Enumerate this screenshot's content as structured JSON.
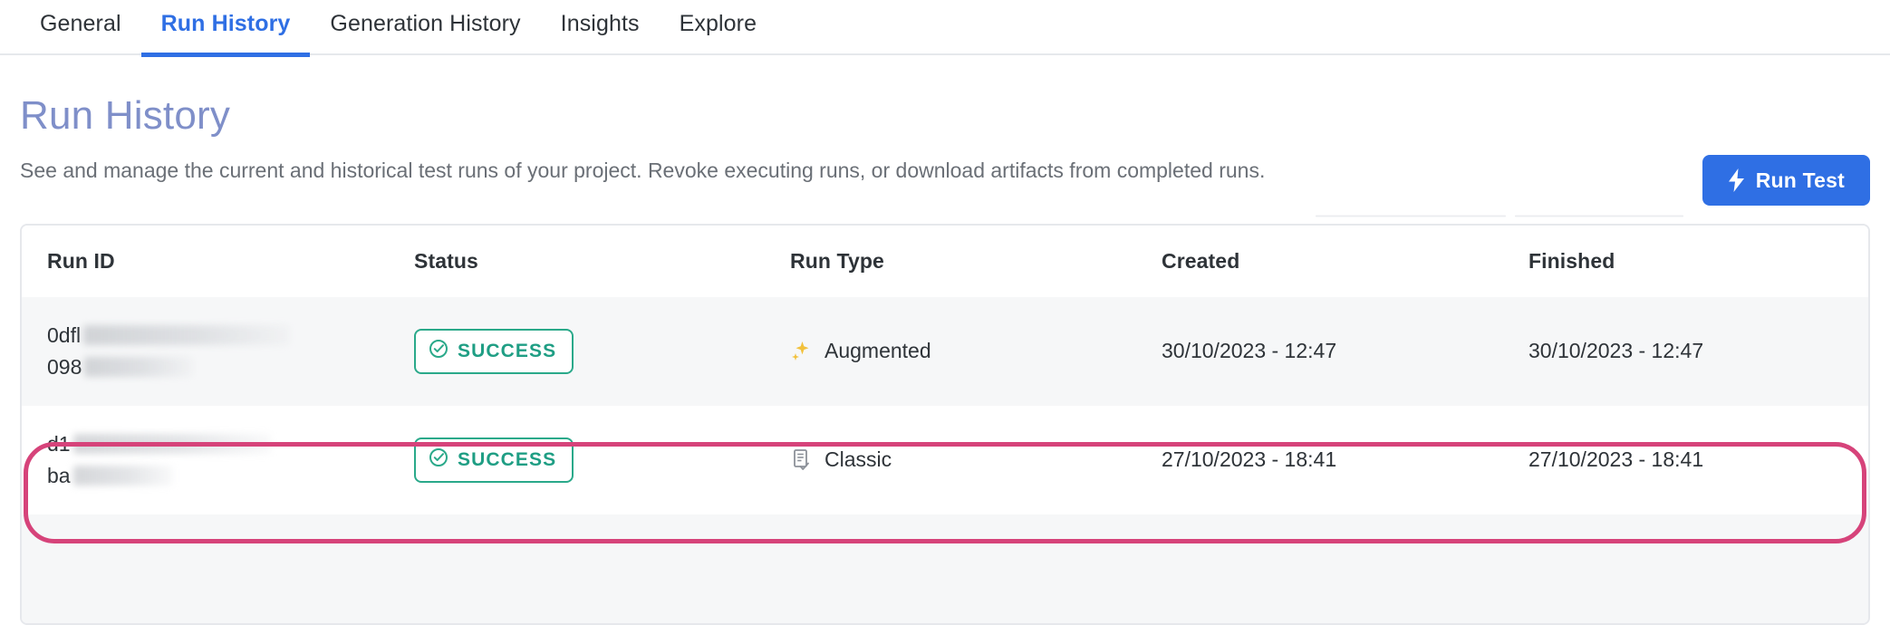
{
  "tabs": [
    {
      "label": "General",
      "active": false
    },
    {
      "label": "Run History",
      "active": true
    },
    {
      "label": "Generation History",
      "active": false
    },
    {
      "label": "Insights",
      "active": false
    },
    {
      "label": "Explore",
      "active": false
    }
  ],
  "header": {
    "title": "Run History",
    "description": "See and manage the current and historical test runs of your project. Revoke executing runs, or download artifacts from completed runs.",
    "run_test_label": "Run Test",
    "run_test_icon": "lightning-bolt-icon"
  },
  "colors": {
    "accent_blue": "#2f6fe4",
    "title_blue": "#7f8fc9",
    "success_green": "#1f9e84",
    "success_border": "#2aa98a",
    "highlight_pink": "#d6437a",
    "row_alt_bg": "#f6f7f8",
    "border_grey": "#e6e8ec",
    "sparkle_yellow": "#f2c13c"
  },
  "table": {
    "columns": [
      "Run ID",
      "Status",
      "Run Type",
      "Created",
      "Finished"
    ],
    "rows": [
      {
        "run_id_line1": "0dfl",
        "run_id_line2": "098",
        "run_id_redacted": true,
        "status": "SUCCESS",
        "status_icon": "check-circle-icon",
        "run_type": "Augmented",
        "run_type_icon": "sparkles-icon",
        "created": "30/10/2023 - 12:47",
        "finished": "30/10/2023 - 12:47",
        "actions_icon": "kebab-menu-icon",
        "highlighted": false
      },
      {
        "run_id_line1": "d1",
        "run_id_line2": "ba",
        "run_id_redacted": true,
        "status": "SUCCESS",
        "status_icon": "check-circle-icon",
        "run_type": "Classic",
        "run_type_icon": "document-check-icon",
        "created": "27/10/2023 - 18:41",
        "finished": "27/10/2023 - 18:41",
        "actions_icon": "kebab-menu-icon",
        "highlighted": true
      }
    ]
  }
}
